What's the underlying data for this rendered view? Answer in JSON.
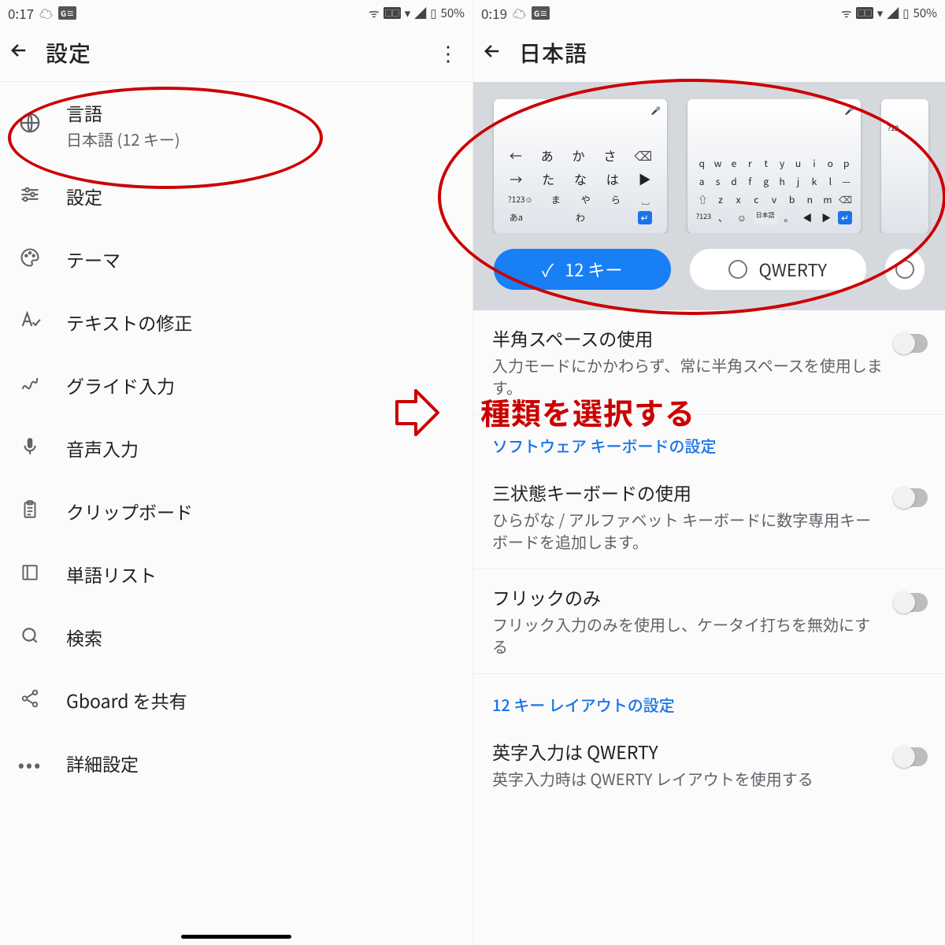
{
  "left": {
    "status": {
      "time": "0:17",
      "battery": "50%"
    },
    "title": "設定",
    "items": [
      {
        "label": "言語",
        "sub": "日本語 (12 キー)",
        "icon": "globe"
      },
      {
        "label": "設定",
        "icon": "sliders"
      },
      {
        "label": "テーマ",
        "icon": "palette"
      },
      {
        "label": "テキストの修正",
        "icon": "textcorrect"
      },
      {
        "label": "グライド入力",
        "icon": "gesture"
      },
      {
        "label": "音声入力",
        "icon": "mic"
      },
      {
        "label": "クリップボード",
        "icon": "clipboard"
      },
      {
        "label": "単語リスト",
        "icon": "book"
      },
      {
        "label": "検索",
        "icon": "search"
      },
      {
        "label": "Gboard を共有",
        "icon": "share"
      },
      {
        "label": "詳細設定",
        "icon": "dots"
      }
    ]
  },
  "right": {
    "status": {
      "time": "0:19",
      "battery": "50%"
    },
    "title": "日本語",
    "layouts": [
      {
        "name": "12 キー",
        "selected": true
      },
      {
        "name": "QWERTY",
        "selected": false
      }
    ],
    "kb12": {
      "r1": [
        "←",
        "あ",
        "か",
        "さ",
        "⌫"
      ],
      "r2": [
        "→",
        "た",
        "な",
        "は",
        "▶"
      ],
      "r3": [
        "?123☺",
        "ま",
        "や",
        "ら",
        "␣"
      ],
      "r4": [
        "あa",
        "",
        "わ",
        "",
        "↵"
      ]
    },
    "kbQwerty": {
      "r1": [
        "q",
        "w",
        "e",
        "r",
        "t",
        "y",
        "u",
        "i",
        "o",
        "p"
      ],
      "r2": [
        "a",
        "s",
        "d",
        "f",
        "g",
        "h",
        "j",
        "k",
        "l",
        "—"
      ],
      "r3": [
        "⇧",
        "z",
        "x",
        "c",
        "v",
        "b",
        "n",
        "m",
        "⌫"
      ],
      "r4": [
        "?123",
        "、",
        "☺",
        "日本語",
        "。",
        "◀",
        "▶",
        "↵"
      ]
    },
    "sections": [
      {
        "items": [
          {
            "title": "半角スペースの使用",
            "sub": "入力モードにかかわらず、常に半角スペースを使用します。"
          }
        ]
      },
      {
        "header": "ソフトウェア キーボードの設定",
        "items": [
          {
            "title": "三状態キーボードの使用",
            "sub": "ひらがな / アルファベット キーボードに数字専用キーボードを追加します。"
          },
          {
            "title": "フリックのみ",
            "sub": "フリック入力のみを使用し、ケータイ打ちを無効にする"
          }
        ]
      },
      {
        "header": "12 キー レイアウトの設定",
        "items": [
          {
            "title": "英字入力は QWERTY",
            "sub": "英字入力時は QWERTY レイアウトを使用する"
          }
        ]
      }
    ]
  },
  "annotation": {
    "text": "種類を選択する"
  }
}
